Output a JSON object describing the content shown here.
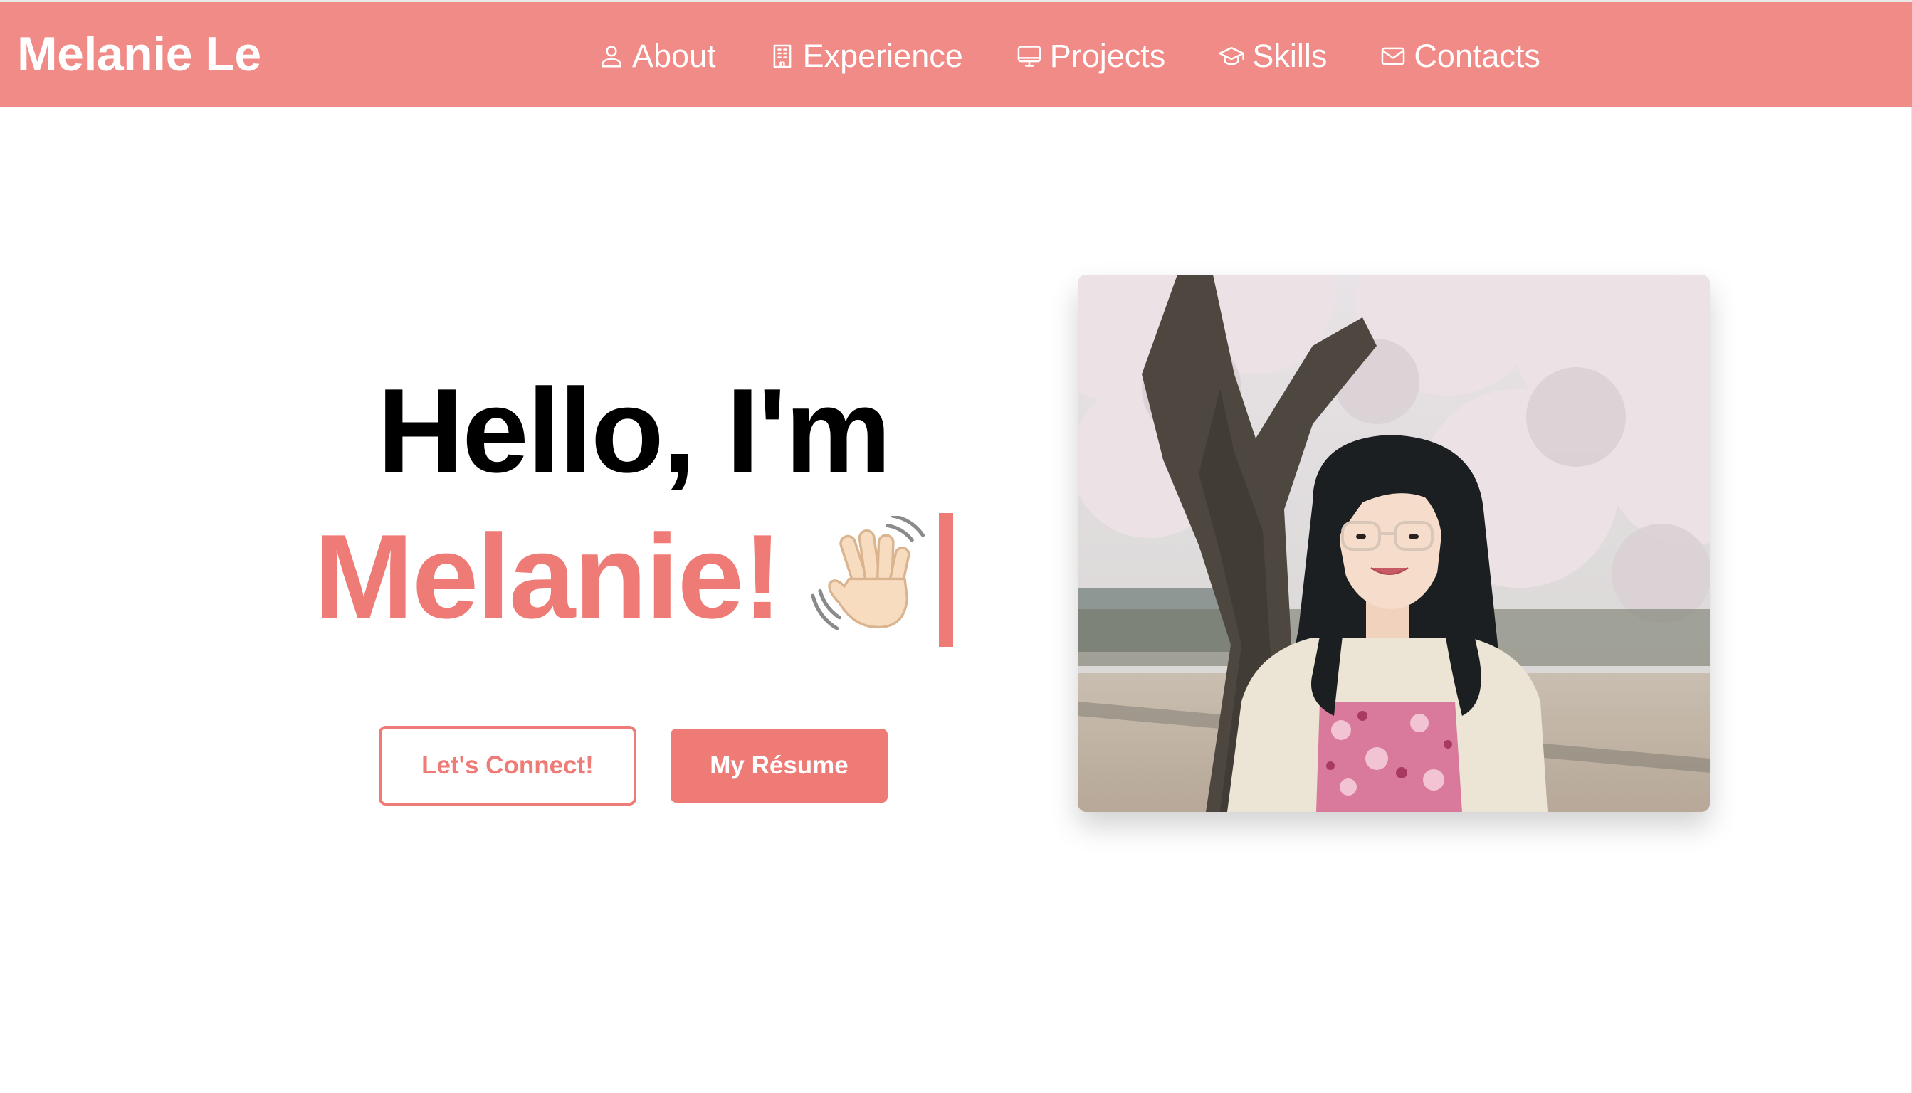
{
  "header": {
    "brand": "Melanie Le",
    "nav": [
      {
        "label": "About",
        "icon": "person-icon"
      },
      {
        "label": "Experience",
        "icon": "building-icon"
      },
      {
        "label": "Projects",
        "icon": "monitor-icon"
      },
      {
        "label": "Skills",
        "icon": "graduation-cap-icon"
      },
      {
        "label": "Contacts",
        "icon": "envelope-icon"
      }
    ]
  },
  "hero": {
    "greeting": "Hello, I'm",
    "name": "Melanie!",
    "wave_icon": "waving-hand-icon",
    "buttons": {
      "connect": "Let's Connect!",
      "resume": "My Résume"
    },
    "photo_icon": "profile-photo"
  },
  "colors": {
    "accent": "#ef7b77",
    "navbar": "#f08b87",
    "background": "#ffffff",
    "text": "#000000"
  }
}
